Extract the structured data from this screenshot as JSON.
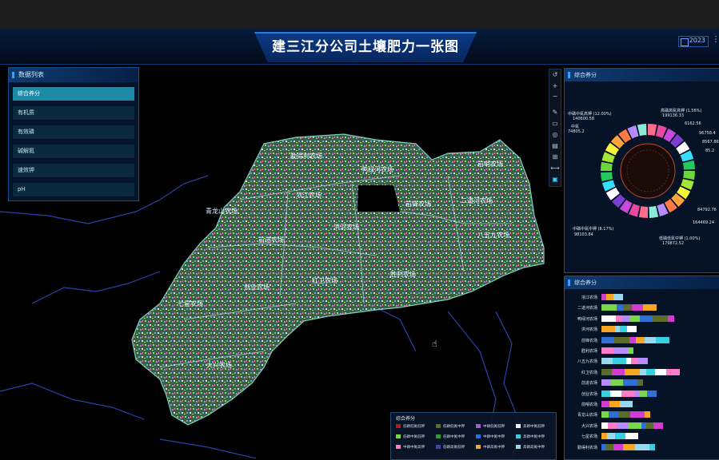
{
  "title": "建三江分公司土壤肥力一张图",
  "header": {
    "date_label": "2023"
  },
  "left_panel": {
    "heading": "数据列表",
    "items": [
      "综合养分",
      "有机质",
      "有效磷",
      "碱解氮",
      "速效钾",
      "pH"
    ],
    "active_index": 0
  },
  "farms": [
    "勤得利农场",
    "青龙山农场",
    "浓江农场",
    "鸭绿河农场",
    "前哨农场",
    "洪河农场",
    "前锋农场",
    "二道河农场",
    "八五九农场",
    "前进农场",
    "创业农场",
    "红卫农场",
    "胜利农场",
    "七星农场",
    "大兴农场"
  ],
  "toolbar": [
    "↺",
    "+",
    "−",
    "✎",
    "▭",
    "◎",
    "▤",
    "⊞",
    "⟷",
    "▣"
  ],
  "pie_panel": {
    "heading": "综合养分",
    "labels": [
      "中磷中氮高钾 (12.00%)",
      "140600.58",
      "高磷高氮高钾 (1.56%)",
      "199136.33",
      "6162.56",
      "96758.4",
      "8567.86",
      "85.2",
      "84792.76",
      "164469.24",
      "低磷低氮中钾 (1.00%)",
      "179872.52",
      "中磷中氮中钾 (8.17%)",
      "98103.84",
      "中氮",
      "74805.2"
    ],
    "colors": [
      "#ff6b8a",
      "#e94aa0",
      "#c74ad8",
      "#7a3fd0",
      "#ffffff",
      "#38e0ff",
      "#22c95e",
      "#6ed63d",
      "#a3e635",
      "#f5f53d",
      "#ffa13d",
      "#ff7a45",
      "#b58cff",
      "#8be9d8"
    ]
  },
  "bar_panel": {
    "heading": "综合养分",
    "rows": [
      "浓江农场",
      "二道河农场",
      "鸭绿河农场",
      "洪河农场",
      "前锋农场",
      "胜利农场",
      "八五九农场",
      "红卫农场",
      "前进农场",
      "创业农场",
      "前哨农场",
      "青龙山农场",
      "大兴农场",
      "七星农场",
      "勤得利农场"
    ]
  },
  "legend": {
    "title": "综合养分",
    "items": [
      {
        "label": "低磷低氮低钾",
        "color": "#b4192b"
      },
      {
        "label": "低磷低氮中钾",
        "color": "#5a6b2a"
      },
      {
        "label": "中磷低氮低钾",
        "color": "#a35cc7"
      },
      {
        "label": "高磷中氮低钾",
        "color": "#f0f0f0"
      },
      {
        "label": "低磷中氮低钾",
        "color": "#7ad64a"
      },
      {
        "label": "低磷中氮中钾",
        "color": "#2e9c3a"
      },
      {
        "label": "中磷中氮中钾",
        "color": "#2f6fd6"
      },
      {
        "label": "高磷中氮中钾",
        "color": "#38d0e0"
      },
      {
        "label": "中磷中氮高钾",
        "color": "#ff7ac8"
      },
      {
        "label": "低磷高氮低钾",
        "color": "#3f3fc0"
      },
      {
        "label": "中磷高氮中钾",
        "color": "#f5a623"
      },
      {
        "label": "高磷高氮中钾",
        "color": "#9bd8f0"
      }
    ]
  }
}
